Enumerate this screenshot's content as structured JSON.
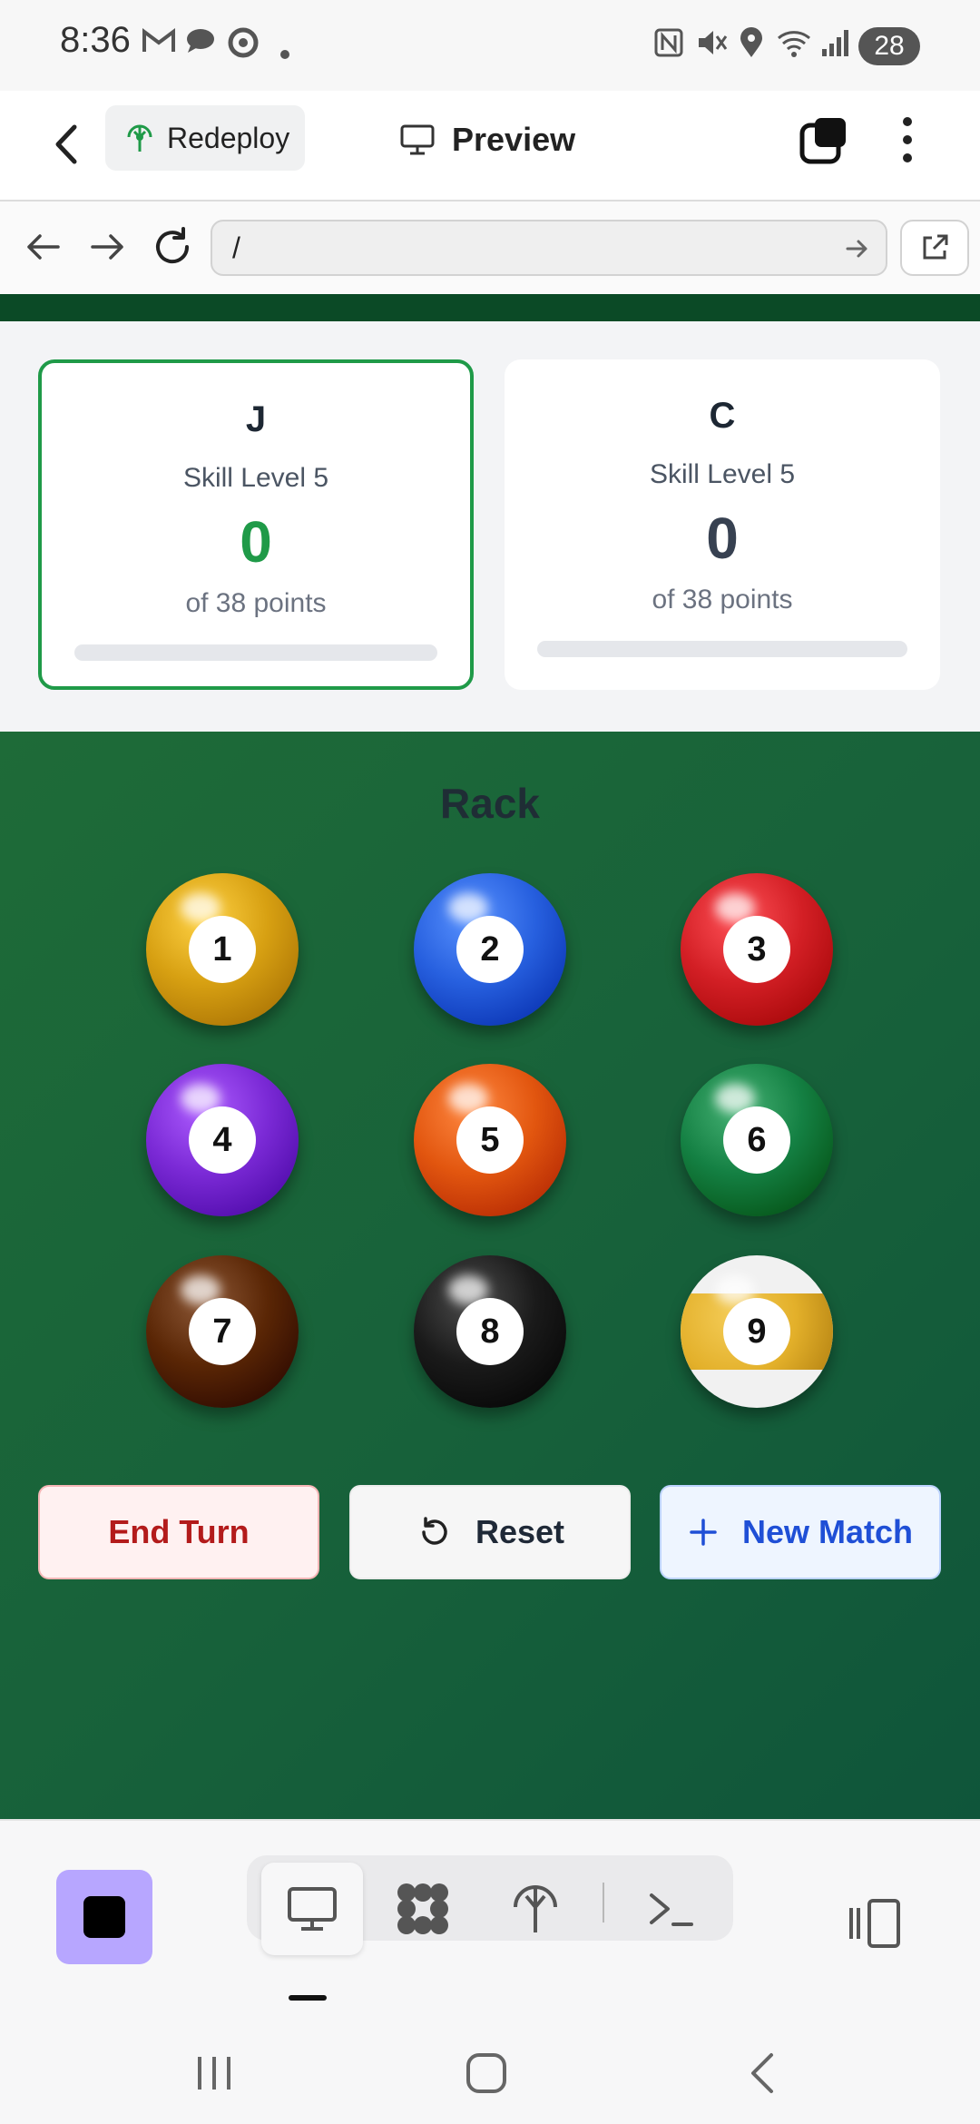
{
  "status_bar": {
    "time": "8:36",
    "battery": "28",
    "icons": [
      "gmail-icon",
      "chat-icon",
      "sync-icon",
      "dot-icon",
      "nfc-icon",
      "mute-icon",
      "location-icon",
      "wifi-icon",
      "signal-icon"
    ]
  },
  "app_bar": {
    "redeploy_label": "Redeploy",
    "preview_label": "Preview"
  },
  "url_bar": {
    "value": "/"
  },
  "players": [
    {
      "name": "J",
      "skill": "Skill Level 5",
      "score": "0",
      "target": "of 38 points",
      "progress": 0,
      "active": true
    },
    {
      "name": "C",
      "skill": "Skill Level 5",
      "score": "0",
      "target": "of 38 points",
      "progress": 0,
      "active": false
    }
  ],
  "rack": {
    "title": "Rack",
    "balls": [
      {
        "number": "1",
        "color": "#d7a012"
      },
      {
        "number": "2",
        "color": "#2760df"
      },
      {
        "number": "3",
        "color": "#d31f25"
      },
      {
        "number": "4",
        "color": "#7b2ad6"
      },
      {
        "number": "5",
        "color": "#e2560f"
      },
      {
        "number": "6",
        "color": "#148043"
      },
      {
        "number": "7",
        "color": "#5a2605"
      },
      {
        "number": "8",
        "color": "#1a1a1a"
      },
      {
        "number": "9",
        "color": "#e6b52b",
        "stripe": true
      }
    ]
  },
  "actions": {
    "end_turn": "End Turn",
    "reset": "Reset",
    "new_match": "New Match"
  },
  "colors": {
    "accent_green": "#1f9a48",
    "felt_green": "#1e6b38",
    "stop_button": "#b7a6ff"
  }
}
